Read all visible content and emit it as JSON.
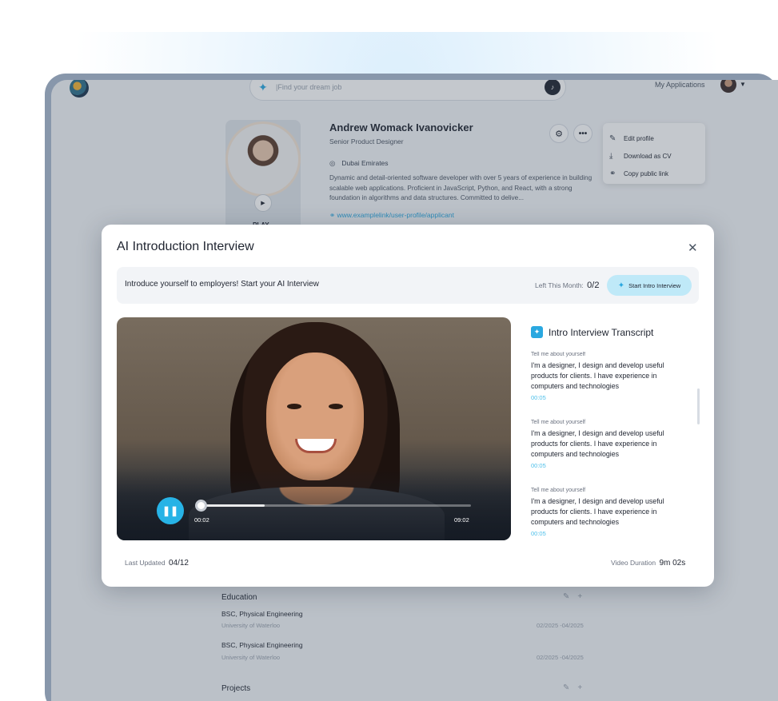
{
  "topbar": {
    "search_placeholder": "|Find your dream job",
    "my_applications": "My Applications"
  },
  "profile": {
    "name": "Andrew Womack Ivanovicker",
    "role": "Senior Product Designer",
    "location": "Dubai Emirates",
    "bio": "Dynamic and detail-oriented software developer with over 5 years of experience in building scalable web applications. Proficient in JavaScript, Python, and React, with a strong foundation in algorithms and data structures. Committed to delive...",
    "link": "www.examplelink/user-profile/applicant",
    "play_label": "PLAY"
  },
  "menu": {
    "items": [
      {
        "label": "Edit profile",
        "icon": "pencil-icon"
      },
      {
        "label": "Download as CV",
        "icon": "download-icon"
      },
      {
        "label": "Copy public link",
        "icon": "link-icon"
      }
    ]
  },
  "education": {
    "title": "Education",
    "entries": [
      {
        "degree": "BSC, Physical Engineering",
        "school": "University of Waterloo",
        "dates": "02/2025 -04/2025"
      },
      {
        "degree": "BSC, Physical Engineering",
        "school": "University of Waterloo",
        "dates": "02/2025 -04/2025"
      }
    ]
  },
  "projects": {
    "title": "Projects"
  },
  "modal": {
    "title": "AI Introduction Interview",
    "banner_text": "Introduce yourself to employers! Start your AI Interview",
    "left_label": "Left This Month:",
    "left_value": "0/2",
    "start_button": "Start Intro Interview",
    "video": {
      "current_time": "00:02",
      "total_time": "09:02",
      "progress": 0.24
    },
    "transcript_title": "Intro Interview Transcript",
    "transcript": [
      {
        "question": "Tell me about yourself",
        "answer": "I'm a designer, I design and develop useful products for clients. I have experience in computers and technologies",
        "time": "00:05"
      },
      {
        "question": "Tell me about yourself",
        "answer": "I'm a designer, I design and develop useful products for clients. I have experience in computers and technologies",
        "time": "00:05"
      },
      {
        "question": "Tell me about yourself",
        "answer": "I'm a designer, I design and develop useful products for clients. I have experience in computers and technologies",
        "time": "00:05"
      }
    ],
    "last_updated_label": "Last Updated",
    "last_updated_value": "04/12",
    "duration_label": "Video Duration",
    "duration_value": "9m 02s"
  },
  "colors": {
    "accent": "#2aa8e0",
    "accent_light": "#bfe9f8",
    "device_frame": "#8897ab"
  }
}
